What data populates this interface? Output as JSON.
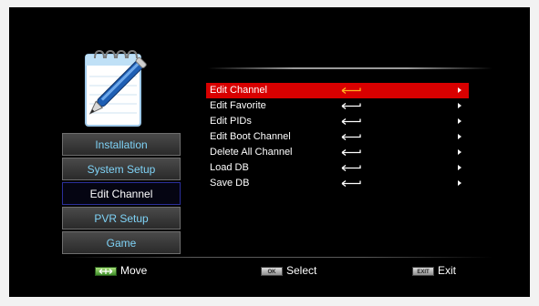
{
  "left_menu": {
    "items": [
      {
        "label": "Installation",
        "active": false
      },
      {
        "label": "System Setup",
        "active": false
      },
      {
        "label": "Edit Channel",
        "active": true
      },
      {
        "label": "PVR Setup",
        "active": false
      },
      {
        "label": "Game",
        "active": false
      }
    ]
  },
  "list": {
    "items": [
      {
        "label": "Edit Channel",
        "selected": true
      },
      {
        "label": "Edit Favorite",
        "selected": false
      },
      {
        "label": "Edit PIDs",
        "selected": false
      },
      {
        "label": "Edit Boot Channel",
        "selected": false
      },
      {
        "label": "Delete All Channel",
        "selected": false
      },
      {
        "label": "Load DB",
        "selected": false
      },
      {
        "label": "Save DB",
        "selected": false
      }
    ]
  },
  "hints": {
    "move": {
      "key": "green-dpad-key",
      "label": "Move"
    },
    "select": {
      "key_text": "OK",
      "label": "Select"
    },
    "exit": {
      "key_text": "EXIT",
      "label": "Exit"
    }
  },
  "colors": {
    "background": "#000000",
    "menu_text": "#7fd3f7",
    "selected_row": "#d80000",
    "selected_arrow": "#ffb020"
  }
}
